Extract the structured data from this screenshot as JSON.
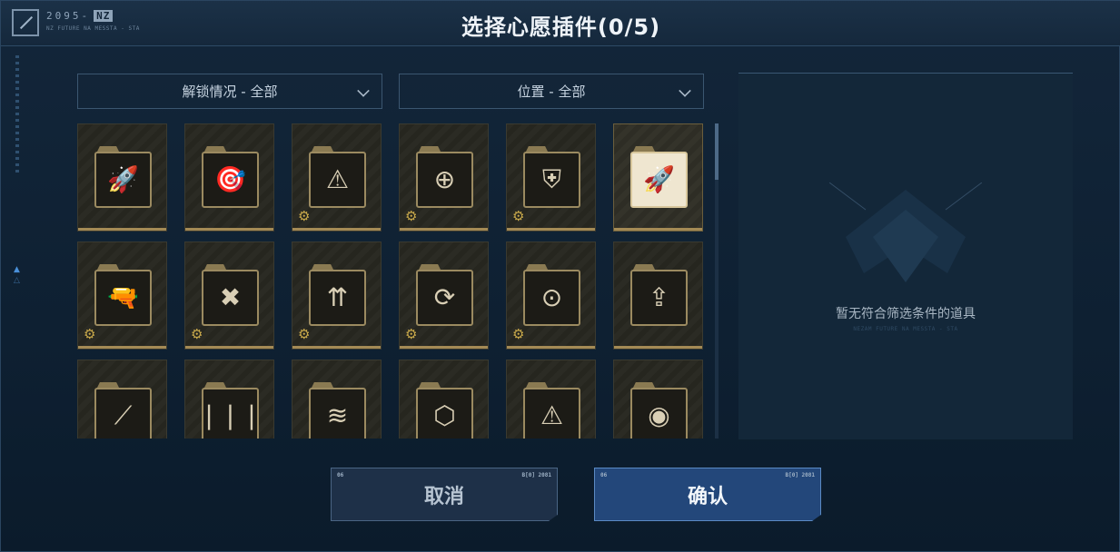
{
  "header": {
    "title": "选择心愿插件(0/5)",
    "logo_text": "2095-",
    "logo_badge": "NZ",
    "logo_sub": "NZ FUTURE NA MESSTA - STA"
  },
  "filters": {
    "unlock": "解锁情况 - 全部",
    "position": "位置 - 全部"
  },
  "plugins": [
    {
      "icon": "rockets-cycle-icon",
      "glyph": "🚀",
      "gear": false,
      "selected": false
    },
    {
      "icon": "head-target-ammo-icon",
      "glyph": "🎯",
      "gear": false,
      "selected": false
    },
    {
      "icon": "ammo-warning-icon",
      "glyph": "⚠",
      "gear": true,
      "selected": false
    },
    {
      "icon": "crosshair-ammo-icon",
      "glyph": "⊕",
      "gear": true,
      "selected": false
    },
    {
      "icon": "armor-ammo-icon",
      "glyph": "⛨",
      "gear": true,
      "selected": false
    },
    {
      "icon": "missiles-icon",
      "glyph": "🚀",
      "gear": false,
      "selected": true
    },
    {
      "icon": "gun-ammo-icon",
      "glyph": "🔫",
      "gear": true,
      "selected": false
    },
    {
      "icon": "shield-cross-icon",
      "glyph": "✖",
      "gear": true,
      "selected": false
    },
    {
      "icon": "bullets-up-icon",
      "glyph": "⇈",
      "gear": true,
      "selected": false
    },
    {
      "icon": "bullet-reload-icon",
      "glyph": "⟳",
      "gear": true,
      "selected": false
    },
    {
      "icon": "target-up-icon",
      "glyph": "⊙",
      "gear": true,
      "selected": false
    },
    {
      "icon": "magazine-up-icon",
      "glyph": "⇪",
      "gear": false,
      "selected": false
    },
    {
      "icon": "rockets-diagonal-icon",
      "glyph": "⟋",
      "gear": false,
      "selected": false
    },
    {
      "icon": "bullets-cycle-icon",
      "glyph": "❘❘❘",
      "gear": false,
      "selected": false
    },
    {
      "icon": "belt-ammo-icon",
      "glyph": "≋",
      "gear": false,
      "selected": false
    },
    {
      "icon": "hex-network-icon",
      "glyph": "⬡",
      "gear": false,
      "selected": false
    },
    {
      "icon": "warning-cycle-icon",
      "glyph": "⚠",
      "gear": false,
      "selected": false
    },
    {
      "icon": "bullet-orbit-icon",
      "glyph": "◉",
      "gear": false,
      "selected": false
    }
  ],
  "preview": {
    "empty_text": "暂无符合筛选条件的道具",
    "empty_sub": "NEZAM FUTURE NA MESSTA - STA"
  },
  "buttons": {
    "cancel": "取消",
    "confirm": "确认",
    "tag_left": "06",
    "tag_right": "B[0] 2081"
  }
}
